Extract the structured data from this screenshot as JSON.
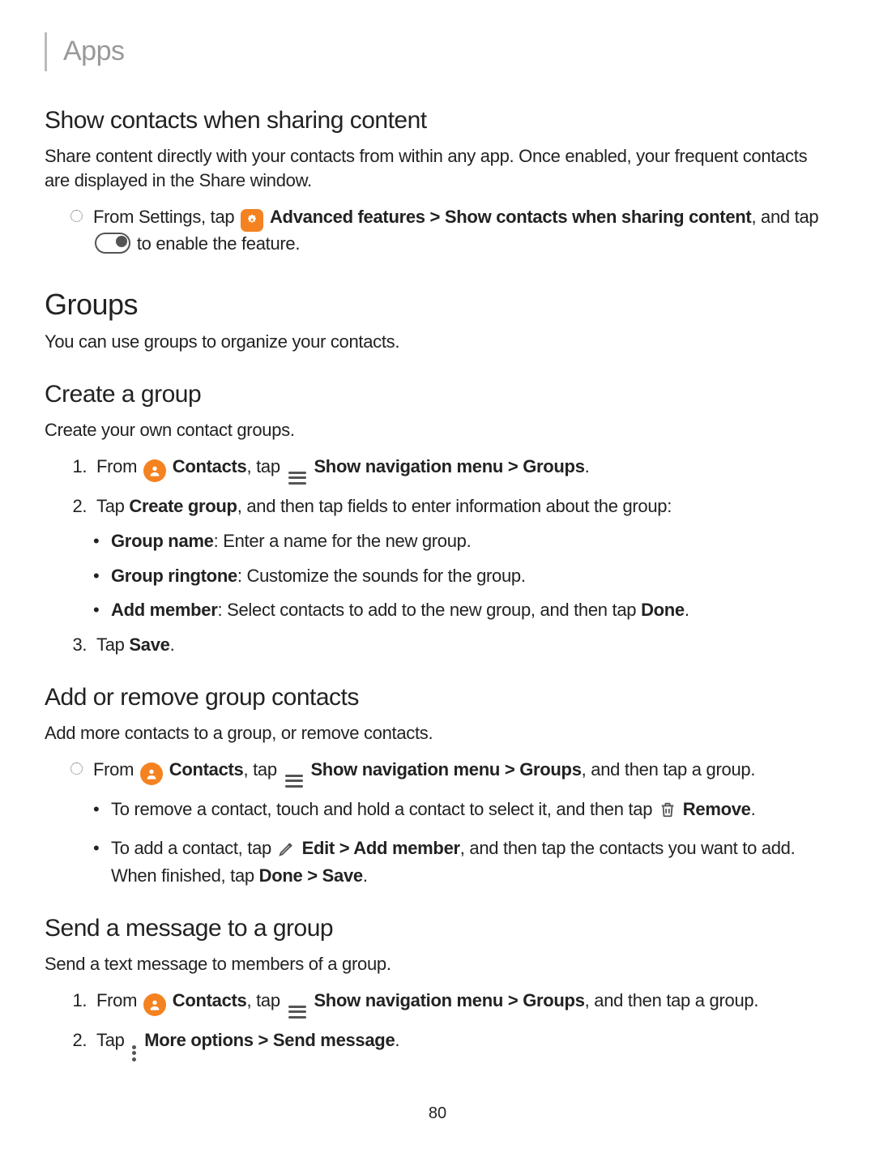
{
  "pageTitle": "Apps",
  "pageNumber": "80",
  "sec1": {
    "heading": "Show contacts when sharing content",
    "intro": "Share content directly with your contacts from within any app. Once enabled, your frequent contacts are displayed in the Share window.",
    "bullet": {
      "t1": "From Settings, tap ",
      "advFeatures": "Advanced features",
      "gt": " > ",
      "showContacts": "Show contacts when sharing content",
      "t2": ", and tap ",
      "t3": " to enable the feature."
    }
  },
  "groups": {
    "heading": "Groups",
    "intro": "You can use groups to organize your contacts."
  },
  "create": {
    "heading": "Create a group",
    "intro": "Create your own contact groups.",
    "step1": {
      "from": "From ",
      "contacts": "Contacts",
      "tap": ", tap ",
      "showNav": "Show navigation menu",
      "gt": " > ",
      "groupsWord": "Groups",
      "period": "."
    },
    "step2": {
      "t1": "Tap ",
      "createGroup": "Create group",
      "t2": ", and then tap fields to enter information about the group:"
    },
    "sub": {
      "name": {
        "label": "Group name",
        "desc": ": Enter a name for the new group."
      },
      "ring": {
        "label": "Group ringtone",
        "desc": ": Customize the sounds for the group."
      },
      "add": {
        "label": "Add member",
        "desc": ": Select contacts to add to the new group, and then tap ",
        "done": "Done",
        "period": "."
      }
    },
    "step3": {
      "tap": "Tap ",
      "save": "Save",
      "period": "."
    }
  },
  "addRemove": {
    "heading": "Add or remove group contacts",
    "intro": "Add more contacts to a group, or remove contacts.",
    "bullet": {
      "from": "From ",
      "contacts": "Contacts",
      "tap": ", tap ",
      "showNav": "Show navigation menu",
      "gt": " > ",
      "groupsWord": "Groups",
      "t2": ", and then tap a group."
    },
    "sub1": {
      "t1": "To remove a contact, touch and hold a contact to select it, and then tap ",
      "remove": "Remove",
      "period": "."
    },
    "sub2": {
      "t1": "To add a contact, tap ",
      "edit": "Edit",
      "gt": " > ",
      "addMember": "Add member",
      "t2": ", and then tap the contacts you want to add. When finished, tap ",
      "done": "Done",
      "gt2": " > ",
      "save": "Save",
      "period": "."
    }
  },
  "send": {
    "heading": "Send a message to a group",
    "intro": "Send a text message to members of a group.",
    "step1": {
      "from": "From ",
      "contacts": "Contacts",
      "tap": ", tap ",
      "showNav": "Show navigation menu",
      "gt": " > ",
      "groupsWord": "Groups",
      "t2": ", and then tap a group."
    },
    "step2": {
      "tap": "Tap ",
      "moreOptions": "More options",
      "gt": " > ",
      "sendMsg": "Send message",
      "period": "."
    }
  }
}
